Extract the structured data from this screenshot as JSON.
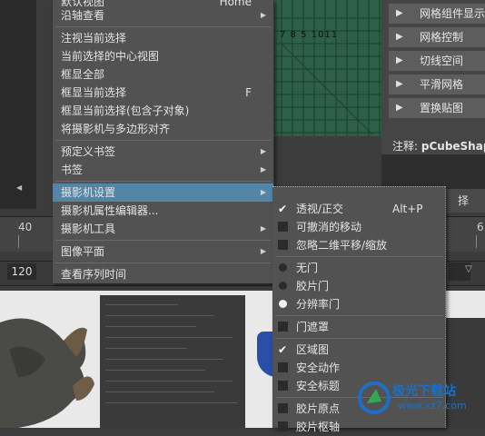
{
  "main_menu": {
    "items": [
      {
        "label": "默认视图",
        "shortcut": "Home",
        "submenu": false
      },
      {
        "label": "沿轴查看",
        "shortcut": "",
        "submenu": true
      },
      {
        "label": "注视当前选择",
        "shortcut": "",
        "submenu": false
      },
      {
        "label": "当前选择的中心视图",
        "shortcut": "",
        "submenu": false
      },
      {
        "label": "框显全部",
        "shortcut": "",
        "submenu": false
      },
      {
        "label": "框显当前选择",
        "shortcut": "F",
        "submenu": false
      },
      {
        "label": "框显当前选择(包含子对象)",
        "shortcut": "",
        "submenu": false
      },
      {
        "label": "将摄影机与多边形对齐",
        "shortcut": "",
        "submenu": false
      },
      {
        "label": "预定义书签",
        "shortcut": "",
        "submenu": true
      },
      {
        "label": "书签",
        "shortcut": "",
        "submenu": true
      },
      {
        "label": "摄影机设置",
        "shortcut": "",
        "submenu": true,
        "highlighted": true
      },
      {
        "label": "摄影机属性编辑器...",
        "shortcut": "",
        "submenu": false
      },
      {
        "label": "摄影机工具",
        "shortcut": "",
        "submenu": true
      },
      {
        "label": "图像平面",
        "shortcut": "",
        "submenu": true
      },
      {
        "label": "查看序列时间",
        "shortcut": "",
        "submenu": false
      }
    ]
  },
  "sub_menu": {
    "items": [
      {
        "label": "透视/正交",
        "shortcut": "Alt+P",
        "control": "checkbox",
        "checked": true
      },
      {
        "label": "可撤消的移动",
        "shortcut": "",
        "control": "checkbox",
        "checked": false
      },
      {
        "label": "忽略二维平移/缩放",
        "shortcut": "",
        "control": "checkbox",
        "checked": false
      },
      {
        "label": "无门",
        "shortcut": "",
        "control": "radio",
        "checked": false
      },
      {
        "label": "胶片门",
        "shortcut": "",
        "control": "radio",
        "checked": false
      },
      {
        "label": "分辨率门",
        "shortcut": "",
        "control": "radio",
        "checked": true
      },
      {
        "label": "门遮罩",
        "shortcut": "",
        "control": "checkbox",
        "checked": false
      },
      {
        "label": "区域图",
        "shortcut": "",
        "control": "checkbox",
        "checked": true
      },
      {
        "label": "安全动作",
        "shortcut": "",
        "control": "checkbox",
        "checked": false
      },
      {
        "label": "安全标题",
        "shortcut": "",
        "control": "checkbox",
        "checked": false
      },
      {
        "label": "胶片原点",
        "shortcut": "",
        "control": "checkbox",
        "checked": false
      },
      {
        "label": "胶片枢轴",
        "shortcut": "",
        "control": "checkbox",
        "checked": false
      }
    ]
  },
  "right_shelf": {
    "items": [
      "网格组件显示",
      "网格控制",
      "切线空间",
      "平滑网格",
      "置换贴图"
    ],
    "note_label": "注释:",
    "note_value": "pCubeShap",
    "side_button": "择"
  },
  "timeline": {
    "ruler_numbers": [
      "40",
      "6"
    ],
    "range_start": "120"
  },
  "viewport": {
    "grid_scale": "7 8 5 1011"
  },
  "watermark": {
    "name": "极光下载站",
    "url": "www.xz7.com"
  },
  "colors": {
    "menu_bg": "#525252",
    "highlight": "#5285a6",
    "grid": "#2d6046"
  }
}
